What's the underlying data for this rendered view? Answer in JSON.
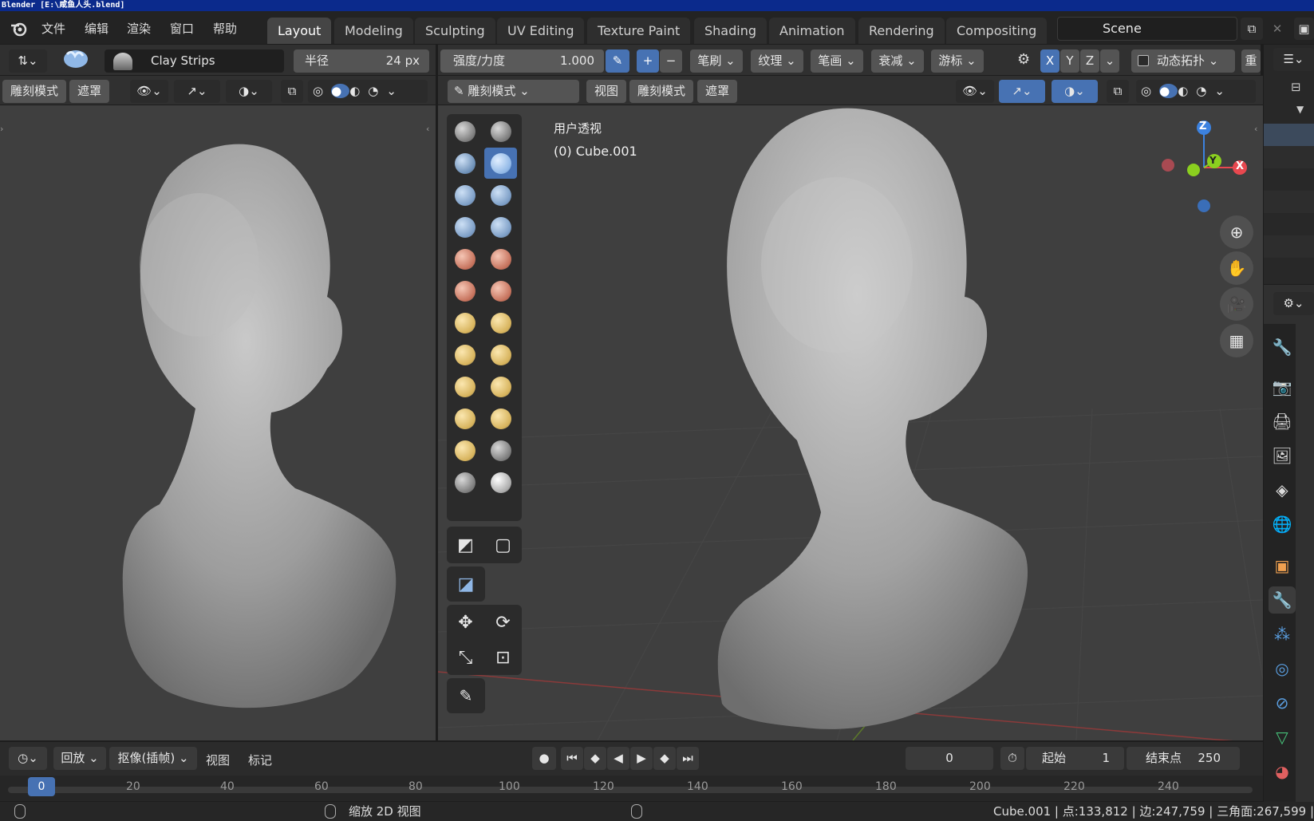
{
  "window_title": "Blender [E:\\咸鱼人头.blend]",
  "menu": [
    "文件",
    "编辑",
    "渲染",
    "窗口",
    "帮助"
  ],
  "workspaces": [
    "Layout",
    "Modeling",
    "Sculpting",
    "UV Editing",
    "Texture Paint",
    "Shading",
    "Animation",
    "Rendering",
    "Compositing"
  ],
  "active_workspace": "Layout",
  "scene_name": "Scene",
  "tool_header": {
    "brush_name": "Clay Strips",
    "radius_label": "半径",
    "radius_value": "24 px",
    "strength_label": "强度/力度",
    "strength_value": "1.000",
    "plus": "+",
    "minus": "−",
    "dropdowns": [
      "笔刷",
      "纹理",
      "笔画",
      "衰减",
      "游标"
    ],
    "axes": [
      "X",
      "Y",
      "Z"
    ],
    "dyntopo": "动态拓扑",
    "remesh": "重"
  },
  "left_viewport": {
    "mode_label": "雕刻模式",
    "mask_label": "遮罩"
  },
  "main_viewport": {
    "mode_label": "雕刻模式",
    "menus": [
      "视图",
      "雕刻模式",
      "遮罩"
    ],
    "view_name": "用户透视",
    "object_info": "(0) Cube.001",
    "gizmo": {
      "x": "X",
      "y": "Y",
      "z": "Z"
    }
  },
  "timeline": {
    "playback": "回放",
    "keying": "抠像(插帧)",
    "view": "视图",
    "marker": "标记",
    "current_frame": "0",
    "start_label": "起始",
    "start_value": "1",
    "end_label": "结束点",
    "end_value": "250",
    "ruler": [
      "0",
      "20",
      "40",
      "60",
      "80",
      "100",
      "120",
      "140",
      "160",
      "180",
      "200",
      "220",
      "240"
    ]
  },
  "status": {
    "middle": "缩放 2D 视图",
    "stats": "Cube.001 | 点:133,812 | 边:247,759 | 三角面:267,599 |"
  },
  "colors": {
    "accent": "#4772b3",
    "viewport_bg": "#3f3f3f",
    "header_bg": "#303030",
    "axis_x": "#e8484f",
    "axis_y": "#8bcf1f",
    "axis_z": "#3c82e0"
  }
}
